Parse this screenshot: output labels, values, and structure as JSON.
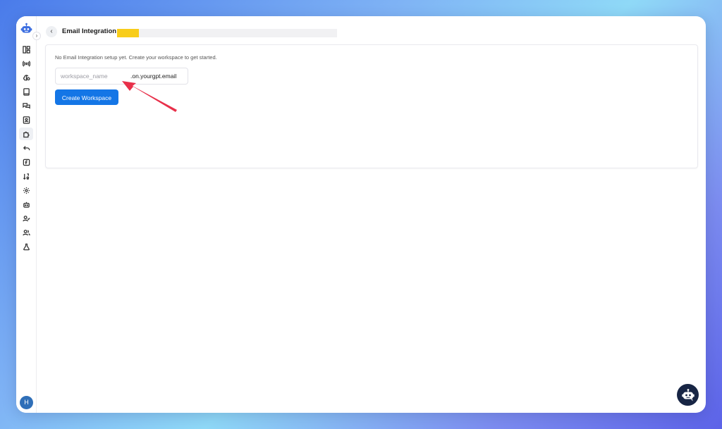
{
  "header": {
    "back_icon": "chevron-left-icon",
    "title": "Email Integration",
    "progress": 0.1
  },
  "sidebar": {
    "logo_icon": "robot-logo-icon",
    "expand_icon": "chevron-right-icon",
    "items": [
      {
        "icon": "dashboard-icon"
      },
      {
        "icon": "broadcast-icon"
      },
      {
        "icon": "brain-icon"
      },
      {
        "icon": "book-icon"
      },
      {
        "icon": "chat-bubbles-icon"
      },
      {
        "icon": "contacts-icon"
      },
      {
        "icon": "puzzle-icon",
        "active": true
      },
      {
        "icon": "reply-icon"
      },
      {
        "icon": "function-icon"
      },
      {
        "icon": "sort-icon"
      },
      {
        "icon": "settings-gear-icon"
      },
      {
        "icon": "bot-icon"
      },
      {
        "icon": "user-check-icon"
      },
      {
        "icon": "users-icon"
      },
      {
        "icon": "flask-icon"
      }
    ],
    "avatar_initial": "H"
  },
  "main": {
    "empty_message": "No Email Integration setup yet. Create your workspace to get started.",
    "workspace_input": {
      "placeholder": "workspace_name",
      "value": "",
      "suffix": ".on.yourgpt.email"
    },
    "create_button_label": "Create Workspace"
  },
  "chat_widget": {
    "icon": "chatbot-icon"
  },
  "colors": {
    "primary": "#1476e6",
    "highlight": "#f8cd1b",
    "annotation_arrow": "#e8304a",
    "chat_widget_bg": "#172544"
  }
}
